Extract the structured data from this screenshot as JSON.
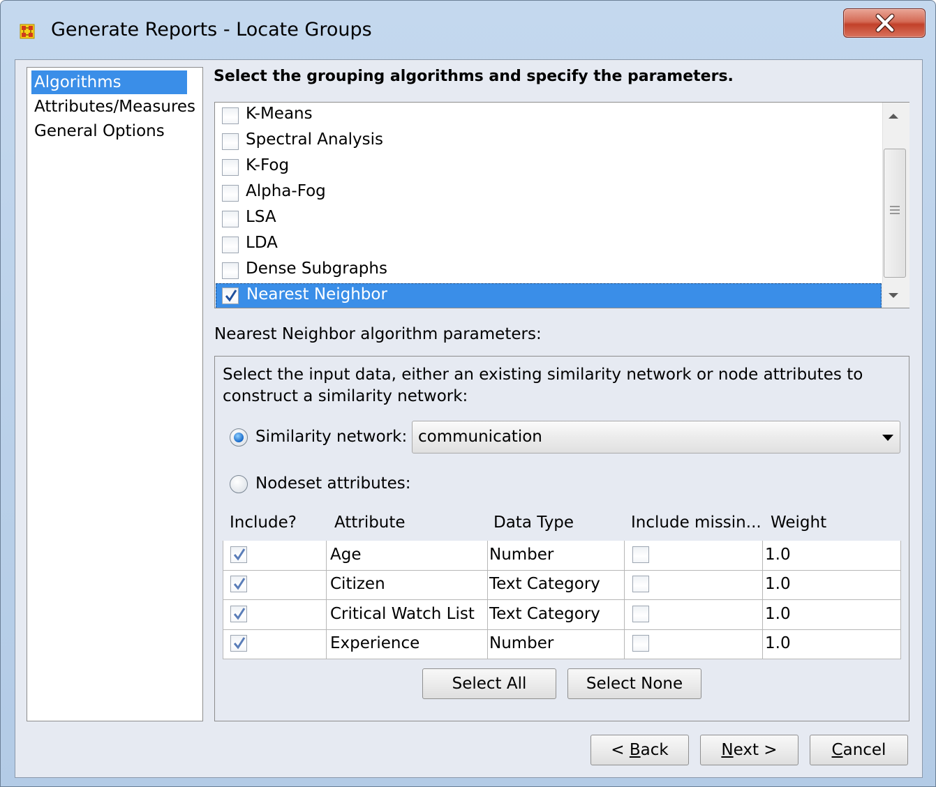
{
  "window": {
    "title": "Generate Reports - Locate Groups"
  },
  "nav": {
    "items": [
      {
        "label": "Algorithms",
        "selected": true
      },
      {
        "label": "Attributes/Measures",
        "selected": false
      },
      {
        "label": "General Options",
        "selected": false
      }
    ]
  },
  "algorithms": {
    "heading": "Select the grouping algorithms and specify the parameters.",
    "items": [
      {
        "label": "K-Means",
        "checked": false,
        "selected": false
      },
      {
        "label": "Spectral Analysis",
        "checked": false,
        "selected": false
      },
      {
        "label": "K-Fog",
        "checked": false,
        "selected": false
      },
      {
        "label": "Alpha-Fog",
        "checked": false,
        "selected": false
      },
      {
        "label": "LSA",
        "checked": false,
        "selected": false
      },
      {
        "label": "LDA",
        "checked": false,
        "selected": false
      },
      {
        "label": "Dense Subgraphs",
        "checked": false,
        "selected": false
      },
      {
        "label": "Nearest Neighbor",
        "checked": true,
        "selected": true
      }
    ]
  },
  "params": {
    "label": "Nearest Neighbor algorithm parameters:",
    "description": "Select the input data, either an existing similarity network or node attributes to construct a similarity network:",
    "similarity_radio": {
      "label": "Similarity network:",
      "selected": true
    },
    "similarity_value": "communication",
    "nodeset_radio": {
      "label": "Nodeset attributes:",
      "selected": false
    },
    "columns": [
      "Include?",
      "Attribute",
      "Data Type",
      "Include missin...",
      "Weight"
    ],
    "rows": [
      {
        "include": true,
        "attribute": "Age",
        "type": "Number",
        "missing": false,
        "weight": "1.0"
      },
      {
        "include": true,
        "attribute": "Citizen",
        "type": "Text Category",
        "missing": false,
        "weight": "1.0"
      },
      {
        "include": true,
        "attribute": "Critical Watch List",
        "type": "Text Category",
        "missing": false,
        "weight": "1.0"
      },
      {
        "include": true,
        "attribute": "Experience",
        "type": "Number",
        "missing": false,
        "weight": "1.0"
      }
    ],
    "select_all": "Select All",
    "select_none": "Select None"
  },
  "footer": {
    "back": {
      "pre": "< ",
      "key": "B",
      "rest": "ack"
    },
    "next": {
      "pre": "",
      "key": "N",
      "rest": "ext >"
    },
    "cancel": {
      "pre": "",
      "key": "C",
      "rest": "ancel"
    }
  },
  "colors": {
    "selection": "#3a8ee8",
    "close_button": "#c94a33",
    "panel_background": "#e6eaf2"
  }
}
